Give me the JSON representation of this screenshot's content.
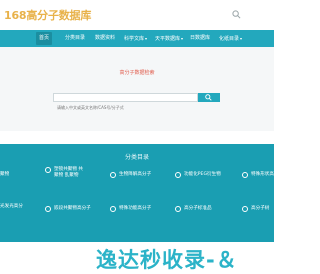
{
  "header": {
    "logo": "168高分子数据库"
  },
  "nav": {
    "items": [
      {
        "label": "首页",
        "active": true
      },
      {
        "label": "分类目录"
      },
      {
        "label": "数据资料"
      },
      {
        "label": "科学文库",
        "dropdown": true
      },
      {
        "label": "天平数据库",
        "dropdown": true
      },
      {
        "label": "日数据库"
      },
      {
        "label": "化纸目录",
        "dropdown": true
      }
    ]
  },
  "hero": {
    "title": "高分子数据检索",
    "search_placeholder": "请输入中文或英文名称/CAS号/分子式"
  },
  "categories": {
    "title": "分类目录",
    "items": [
      "聚物",
      "塑锁共聚物 共聚物 乱聚物",
      "生物降解高分子",
      "功能化PEG衍生物",
      "特殊形状高",
      "光发光高分",
      "嵌段共聚物高分子",
      "特殊功能高分子",
      "高分子标准品",
      "高分子树"
    ]
  },
  "watermark": {
    "text": "逸达秒收录-＆"
  }
}
